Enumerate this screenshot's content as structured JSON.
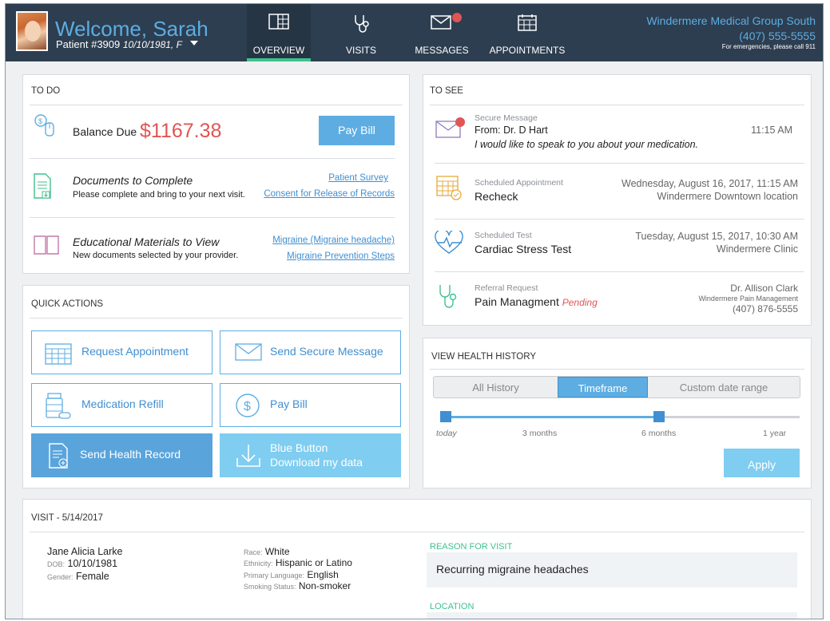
{
  "header": {
    "welcome": "Welcome, Sarah",
    "patient_id": "Patient #3909",
    "patient_meta": "10/10/1981, F",
    "nav": [
      {
        "label": "OVERVIEW",
        "icon": "overview-icon"
      },
      {
        "label": "VISITS",
        "icon": "stethoscope-icon"
      },
      {
        "label": "MESSAGES",
        "icon": "envelope-icon"
      },
      {
        "label": "APPOINTMENTS",
        "icon": "calendar-icon"
      }
    ],
    "org_name": "Windermere Medical Group South",
    "org_phone": "(407) 555-5555",
    "emergency": "For emergencies, please call 911"
  },
  "todo": {
    "title": "TO DO",
    "balance_label": "Balance Due",
    "balance_amount": "$1167.38",
    "pay_button": "Pay Bill",
    "documents_title": "Documents to Complete",
    "documents_sub": "Please complete and bring to your next visit.",
    "documents_links": [
      "Patient Survey",
      "Consent for Release of Records"
    ],
    "edu_title": "Educational Materials to View",
    "edu_sub": "New documents selected by your provider.",
    "edu_links": [
      "Migraine (Migraine headache)",
      "Migraine Prevention Steps"
    ]
  },
  "quick_actions": {
    "title": "QUICK ACTIONS",
    "buttons": [
      {
        "label": "Request Appointment",
        "icon": "calendar-icon"
      },
      {
        "label": "Send Secure Message",
        "icon": "envelope-icon"
      },
      {
        "label": "Medication Refill",
        "icon": "pill-bottle-icon"
      },
      {
        "label": "Pay Bill",
        "icon": "dollar-icon"
      },
      {
        "label": "Send Health Record",
        "icon": "health-record-icon"
      },
      {
        "label_line1": "Blue Button",
        "label_line2": "Download my data",
        "icon": "download-icon"
      }
    ]
  },
  "tosee": {
    "title": "TO SEE",
    "items": [
      {
        "type": "Secure Message",
        "main": "From: Dr. D Hart",
        "sub": "I would like to speak to you about your medication.",
        "right1": "11:15 AM"
      },
      {
        "type": "Scheduled Appointment",
        "main": "Recheck",
        "right1": "Wednesday, August 16, 2017, 11:15 AM",
        "right2": "Windermere Downtown location"
      },
      {
        "type": "Scheduled Test",
        "main": "Cardiac Stress Test",
        "right1": "Tuesday, August 15, 2017, 10:30 AM",
        "right2": "Windermere Clinic"
      },
      {
        "type": "Referral Request",
        "main": "Pain Managment",
        "status": "Pending",
        "right1": "Dr. Allison Clark",
        "right2": "Windermere Pain Management",
        "right3": "(407) 876-5555"
      }
    ]
  },
  "history": {
    "title": "VIEW HEALTH HISTORY",
    "tabs": [
      "All History",
      "Timeframe",
      "Custom date range"
    ],
    "active_tab": "Timeframe",
    "ticks": [
      "today",
      "3 months",
      "6 months",
      "1 year"
    ],
    "range_selected": "today to 6 months",
    "apply": "Apply"
  },
  "visit": {
    "title": "VISIT - 5/14/2017",
    "name": "Jane Alicia Larke",
    "dob_label": "DOB:",
    "dob": "10/10/1981",
    "gender_label": "Gender:",
    "gender": "Female",
    "race_label": "Race:",
    "race": "White",
    "ethnicity_label": "Ethnicity:",
    "ethnicity": "Hispanic or Latino",
    "language_label": "Primary Language:",
    "language": "English",
    "smoking_label": "Smoking Status:",
    "smoking": "Non-smoker",
    "reason_label": "REASON FOR VISIT",
    "reason": "Recurring migraine headaches",
    "location_label": "LOCATION"
  },
  "colors": {
    "header_bg": "#2d3e50",
    "accent_blue": "#5dade2",
    "balance_red": "#e05555",
    "green": "#3ec28f",
    "pending_red": "#e05555"
  }
}
